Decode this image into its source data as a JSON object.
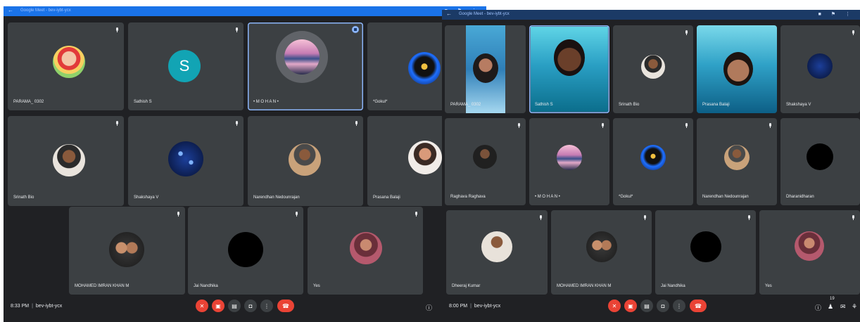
{
  "left_window": {
    "titlebar_text": "Google Meet - bev-iybt-ycx",
    "tiles": [
      {
        "name": "PARAMA_ 0302"
      },
      {
        "name": "Sathish S",
        "initial": "S"
      },
      {
        "name": "• M O H A N •"
      },
      {
        "name": "*Gokul*"
      },
      {
        "name": "Srinath Bio"
      },
      {
        "name": "Shakshaya V"
      },
      {
        "name": "Narendhan Nedounrajan"
      },
      {
        "name": "Prasana Balaji"
      },
      {
        "name": "MOHAMED IMRAN KHAN M"
      },
      {
        "name": "Jai Nandhika"
      },
      {
        "name": "Yes"
      }
    ],
    "time": "8:33 PM",
    "meeting_code": "bev-iybt-ycx"
  },
  "right_window": {
    "titlebar_text": "Google Meet - bev-iybt-ycx",
    "tiles": [
      {
        "name": "PARAMA_ 0302"
      },
      {
        "name": "Sathish S"
      },
      {
        "name": "Srinath Bio"
      },
      {
        "name": "Prasana Balaji"
      },
      {
        "name": "Shakshaya V"
      },
      {
        "name": "Raghava Raghava"
      },
      {
        "name": "• M O H A N •"
      },
      {
        "name": "*Gokul*"
      },
      {
        "name": "Narendhan Nedounrajan"
      },
      {
        "name": "Dharanidharan"
      },
      {
        "name": "Dheeraj Kumar"
      },
      {
        "name": "MOHAMED IMRAN KHAN M"
      },
      {
        "name": "Jai Nandhika"
      },
      {
        "name": "Yes"
      }
    ],
    "time": "8:00 PM",
    "meeting_code": "bev-iybt-ycx",
    "participant_count": "19"
  },
  "colors": {
    "background": "#202124",
    "tile": "#3c4043",
    "accent": "#8ab4f8",
    "danger": "#ea4335",
    "titlebar": "#1a73e8"
  },
  "icons": [
    "mic-icon",
    "camera-off-icon",
    "captions-icon",
    "present-icon",
    "more-icon",
    "end-call-icon",
    "info-icon",
    "people-icon",
    "chat-icon",
    "activities-icon",
    "speaking-icon"
  ]
}
